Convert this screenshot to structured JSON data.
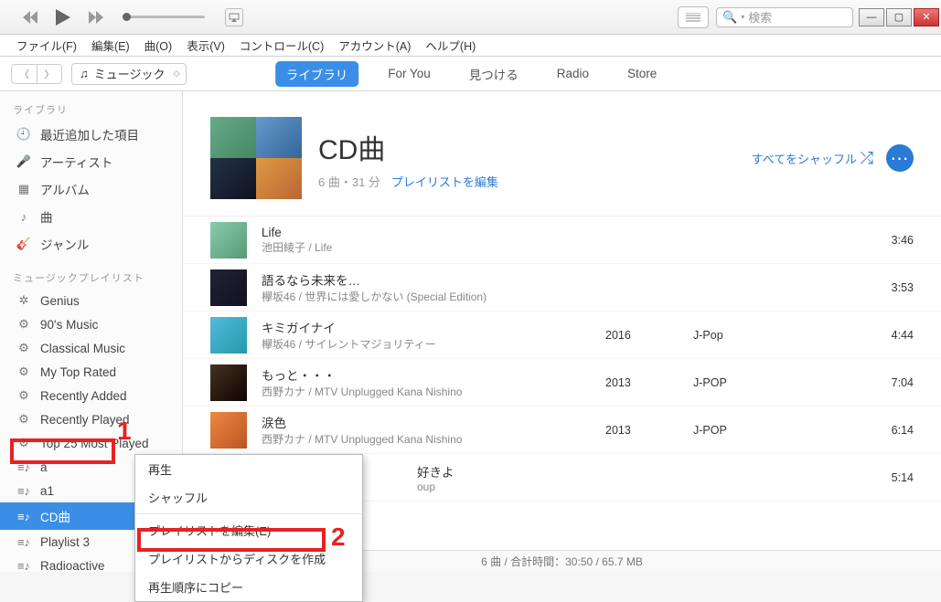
{
  "titlebar": {
    "search_placeholder": "検索"
  },
  "menubar": [
    "ファイル(F)",
    "編集(E)",
    "曲(O)",
    "表示(V)",
    "コントロール(C)",
    "アカウント(A)",
    "ヘルプ(H)"
  ],
  "mediaselector": "ミュージック",
  "tabs": [
    "ライブラリ",
    "For You",
    "見つける",
    "Radio",
    "Store"
  ],
  "sidebar": {
    "section_library": "ライブラリ",
    "library_items": [
      "最近追加した項目",
      "アーティスト",
      "アルバム",
      "曲",
      "ジャンル"
    ],
    "section_playlists": "ミュージックプレイリスト",
    "playlists": [
      "Genius",
      "90's Music",
      "Classical Music",
      "My Top Rated",
      "Recently Added",
      "Recently Played",
      "Top 25 Most Played",
      "a",
      "a1",
      "CD曲",
      "Playlist 3",
      "Radioactive"
    ]
  },
  "header": {
    "title": "CD曲",
    "subtitle_count": "6 曲・31 分",
    "edit_link": "プレイリストを編集",
    "shuffle_all": "すべてをシャッフル"
  },
  "tracks": [
    {
      "title": "Life",
      "artist": "池田綾子 / Life",
      "year": "",
      "genre": "",
      "duration": "3:46"
    },
    {
      "title": "語るなら未来を…",
      "artist": "欅坂46 / 世界には愛しかない (Special Edition)",
      "year": "",
      "genre": "",
      "duration": "3:53"
    },
    {
      "title": "キミガイナイ",
      "artist": "欅坂46 / サイレントマジョリティー",
      "year": "2016",
      "genre": "J-Pop",
      "duration": "4:44"
    },
    {
      "title": "もっと・・・",
      "artist": "西野カナ / MTV Unplugged Kana Nishino",
      "year": "2013",
      "genre": "J-POP",
      "duration": "7:04"
    },
    {
      "title": "涙色",
      "artist": "西野カナ / MTV Unplugged Kana Nishino",
      "year": "2013",
      "genre": "J-POP",
      "duration": "6:14"
    },
    {
      "title": "好きよ",
      "artist": "oup",
      "year": "",
      "genre": "",
      "duration": "5:14"
    }
  ],
  "context_menu": [
    "再生",
    "シャッフル",
    "プレイリストを編集(E)",
    "プレイリストからディスクを作成",
    "再生順序にコピー"
  ],
  "statusbar": "6 曲 / 合計時間：30:50 / 65.7 MB",
  "annotations": {
    "one": "1",
    "two": "2"
  }
}
